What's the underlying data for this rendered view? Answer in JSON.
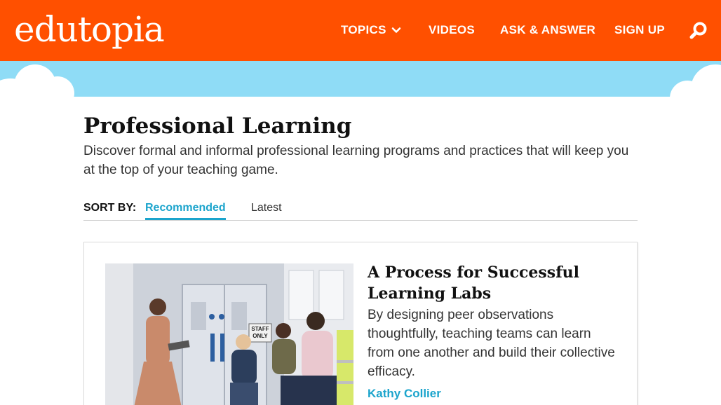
{
  "header": {
    "logo_text": "edutopia",
    "brand_color": "#ff5000",
    "nav": {
      "topics": "TOPICS",
      "videos": "VIDEOS",
      "ask_answer": "ASK & ANSWER",
      "sign_up": "SIGN UP"
    },
    "search_icon": "search-icon",
    "topics_icon": "chevron-down-icon"
  },
  "sky_color": "#8fdcf6",
  "page": {
    "title": "Professional Learning",
    "description": "Discover formal and informal professional learning programs and practices that will keep you at the top of your teaching game."
  },
  "sort": {
    "label": "SORT BY:",
    "options": [
      "Recommended",
      "Latest"
    ],
    "selected": "Recommended",
    "accent_color": "#1ba4cc"
  },
  "articles": [
    {
      "title": "A Process for Successful Learning Labs",
      "summary": "By designing peer observations thoughtfully, teaching teams can learn from one another and build their collective efficacy.",
      "author": "Kathy Collier",
      "image_sign": "STAFF ONLY"
    }
  ]
}
